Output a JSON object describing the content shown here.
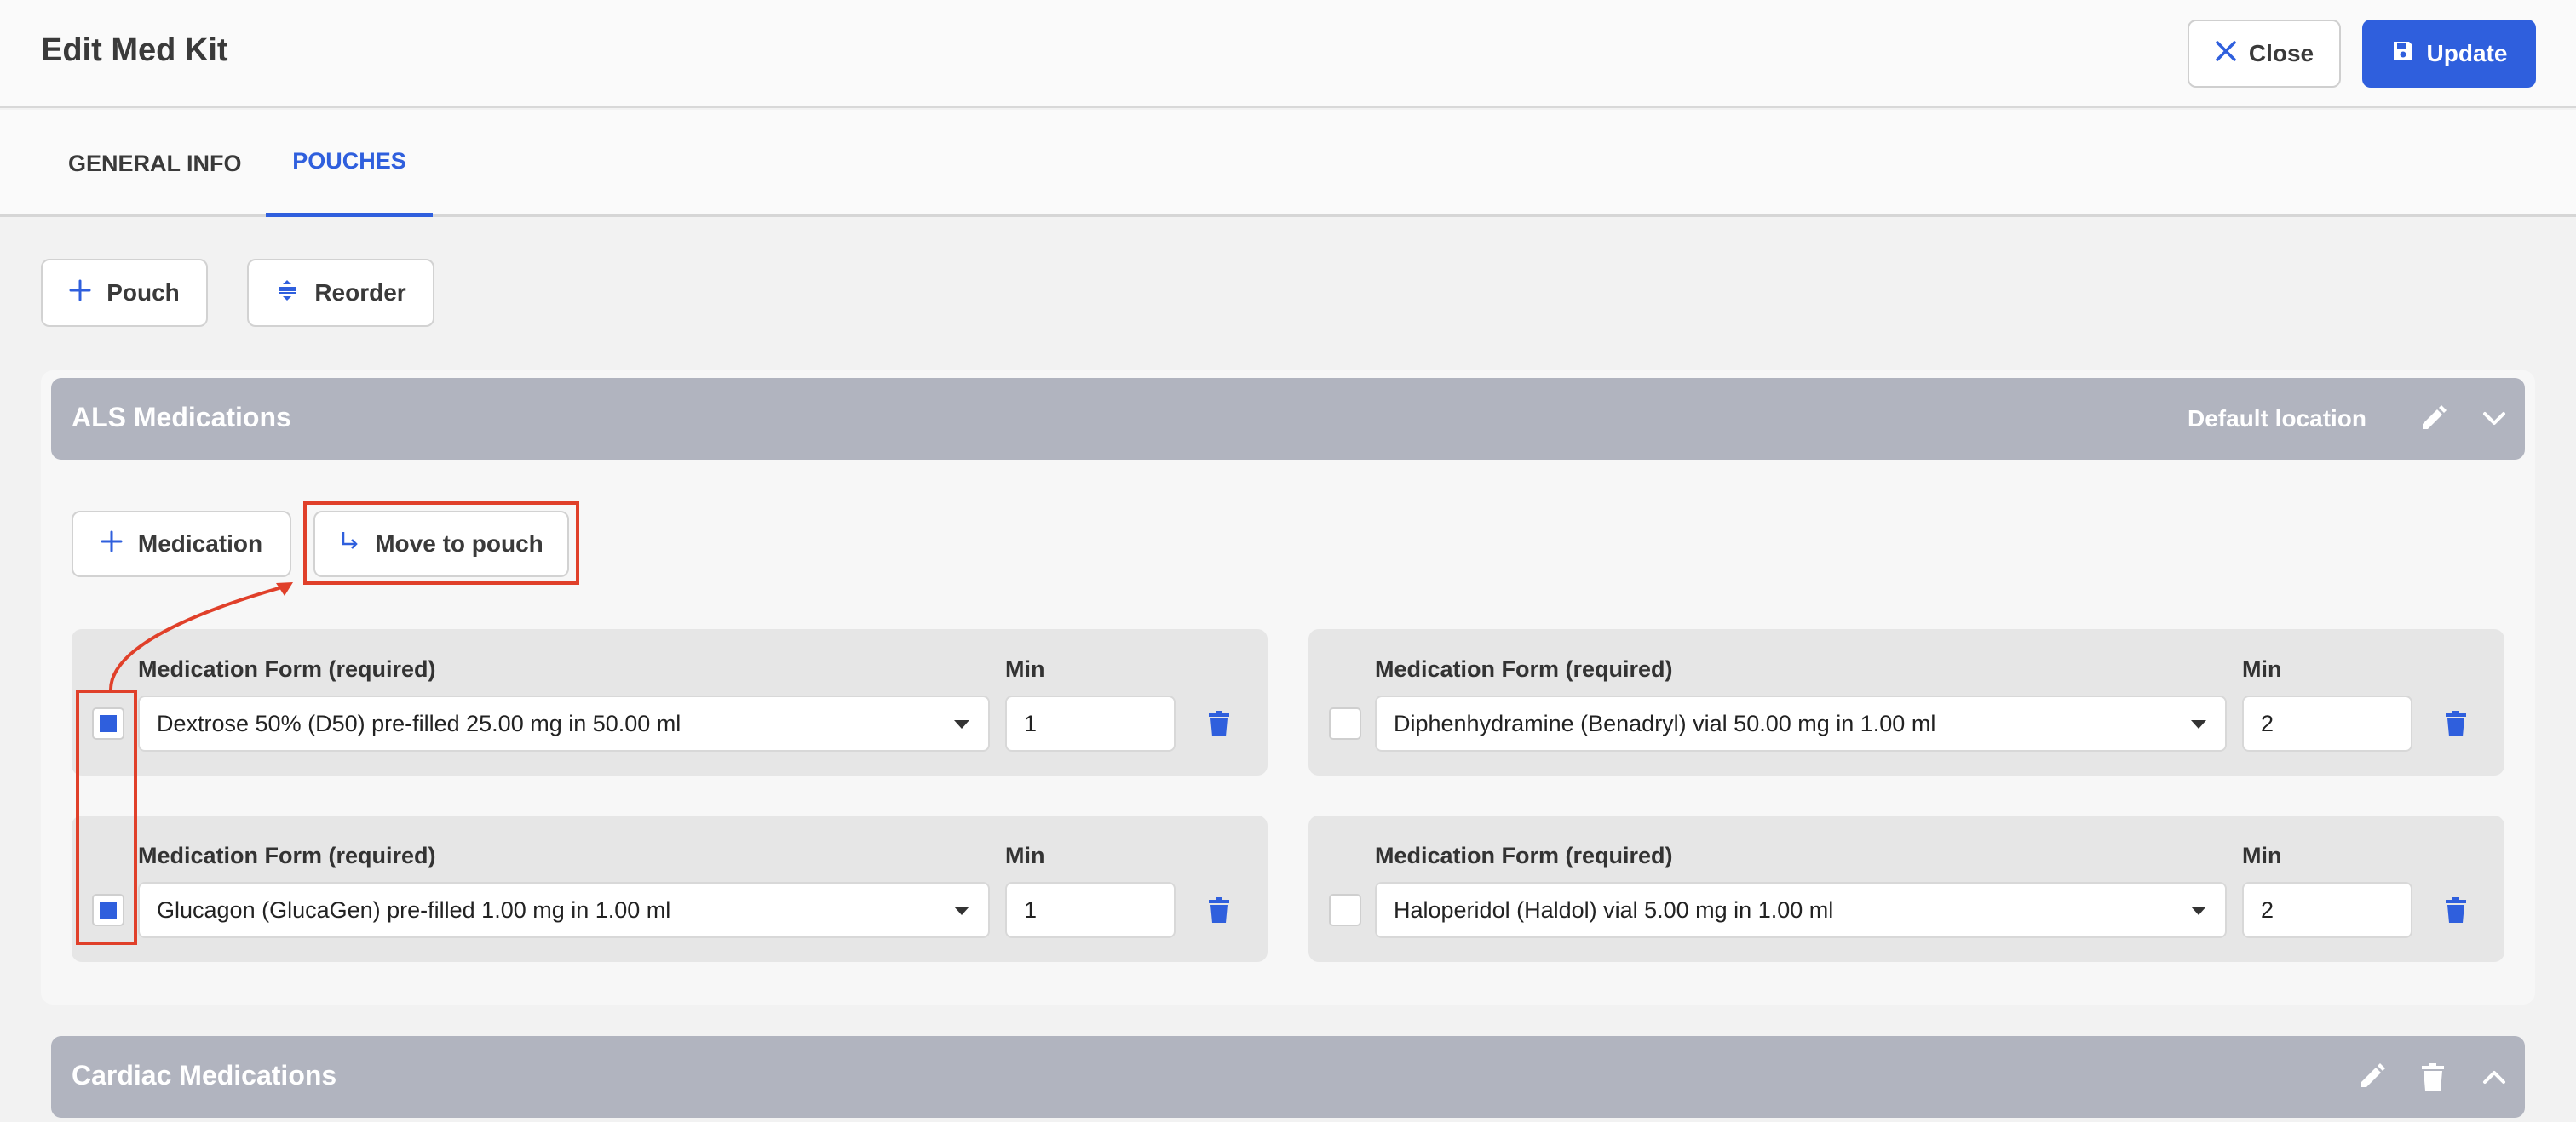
{
  "header": {
    "title": "Edit Med Kit",
    "close_label": "Close",
    "update_label": "Update"
  },
  "tabs": [
    {
      "label": "GENERAL INFO",
      "active": false
    },
    {
      "label": "POUCHES",
      "active": true
    }
  ],
  "toolbar": {
    "add_pouch_label": "Pouch",
    "reorder_label": "Reorder"
  },
  "pouches": [
    {
      "title": "ALS Medications",
      "location": "Default location",
      "add_medication_label": "Medication",
      "move_to_pouch_label": "Move to pouch",
      "medications": [
        {
          "form_label": "Medication Form (required)",
          "form_value": "Dextrose 50% (D50) pre-filled 25.00 mg in 50.00 ml",
          "min_label": "Min",
          "min_value": "1",
          "checked": true
        },
        {
          "form_label": "Medication Form (required)",
          "form_value": "Diphenhydramine (Benadryl) vial 50.00 mg in 1.00 ml",
          "min_label": "Min",
          "min_value": "2",
          "checked": false
        },
        {
          "form_label": "Medication Form (required)",
          "form_value": "Glucagon (GlucaGen) pre-filled 1.00 mg in 1.00 ml",
          "min_label": "Min",
          "min_value": "1",
          "checked": true
        },
        {
          "form_label": "Medication Form (required)",
          "form_value": "Haloperidol (Haldol) vial 5.00 mg in 1.00 ml",
          "min_label": "Min",
          "min_value": "2",
          "checked": false
        }
      ]
    },
    {
      "title": "Cardiac Medications"
    }
  ],
  "colors": {
    "accent": "#2f5fdd",
    "pouch_header": "#b1b4bf",
    "annotation": "#e0402a"
  },
  "icons": {
    "close": "close-icon",
    "update": "save-icon",
    "add": "plus-icon",
    "reorder": "reorder-icon",
    "edit": "pencil-icon",
    "collapse": "chevron-down-icon",
    "expand": "chevron-up-icon",
    "delete": "trash-icon",
    "move": "move-arrow-icon"
  }
}
